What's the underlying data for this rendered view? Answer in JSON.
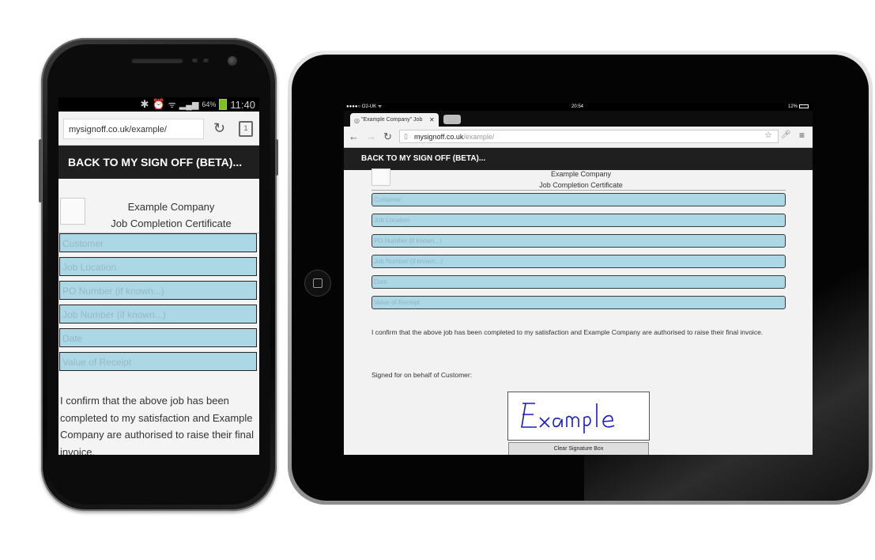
{
  "phone": {
    "status": {
      "time": "11:40",
      "battery": "64%"
    },
    "browser": {
      "url": "mysignoff.co.uk/example/",
      "tab_count": "1"
    },
    "header": "BACK TO MY SIGN OFF (BETA)...",
    "company": "Example Company",
    "certificate": "Job Completion Certificate",
    "fields": [
      {
        "placeholder": "Customer"
      },
      {
        "placeholder": "Job Location"
      },
      {
        "placeholder": "PO Number (if known...)"
      },
      {
        "placeholder": "Job Number (if known...)"
      },
      {
        "placeholder": "Date"
      },
      {
        "placeholder": "Value of Receipt"
      }
    ],
    "confirm_text": "I confirm that the above job has been completed to my satisfaction and Example Company are authorised to raise their final invoice."
  },
  "tablet": {
    "status": {
      "carrier": "●●●●○ O2-UK ᯤ",
      "time": "20:54",
      "battery": "12%"
    },
    "browser": {
      "tab_title": "\"Example Company\" Job",
      "url_host": "mysignoff.co.uk",
      "url_path": "/example/"
    },
    "header": "BACK TO MY SIGN OFF (BETA)...",
    "company": "Example Company",
    "certificate": "Job Completion Certificate",
    "fields": [
      {
        "placeholder": "Customer"
      },
      {
        "placeholder": "Job Location"
      },
      {
        "placeholder": "PO Number (if known...)"
      },
      {
        "placeholder": "Job Number (if known...)"
      },
      {
        "placeholder": "Date"
      },
      {
        "placeholder": "Value of Receipt"
      }
    ],
    "confirm_text": "I confirm that the above job has been completed to my satisfaction and Example Company are authorised to raise their final invoice.",
    "signed_label": "Signed for on behalf of Customer:",
    "signature_text": "Example",
    "clear_button": "Clear Signature Box"
  },
  "colors": {
    "field_bg": "#acd8e6",
    "header_bg": "#1f1f1f",
    "signature_ink": "#1a1acc"
  }
}
